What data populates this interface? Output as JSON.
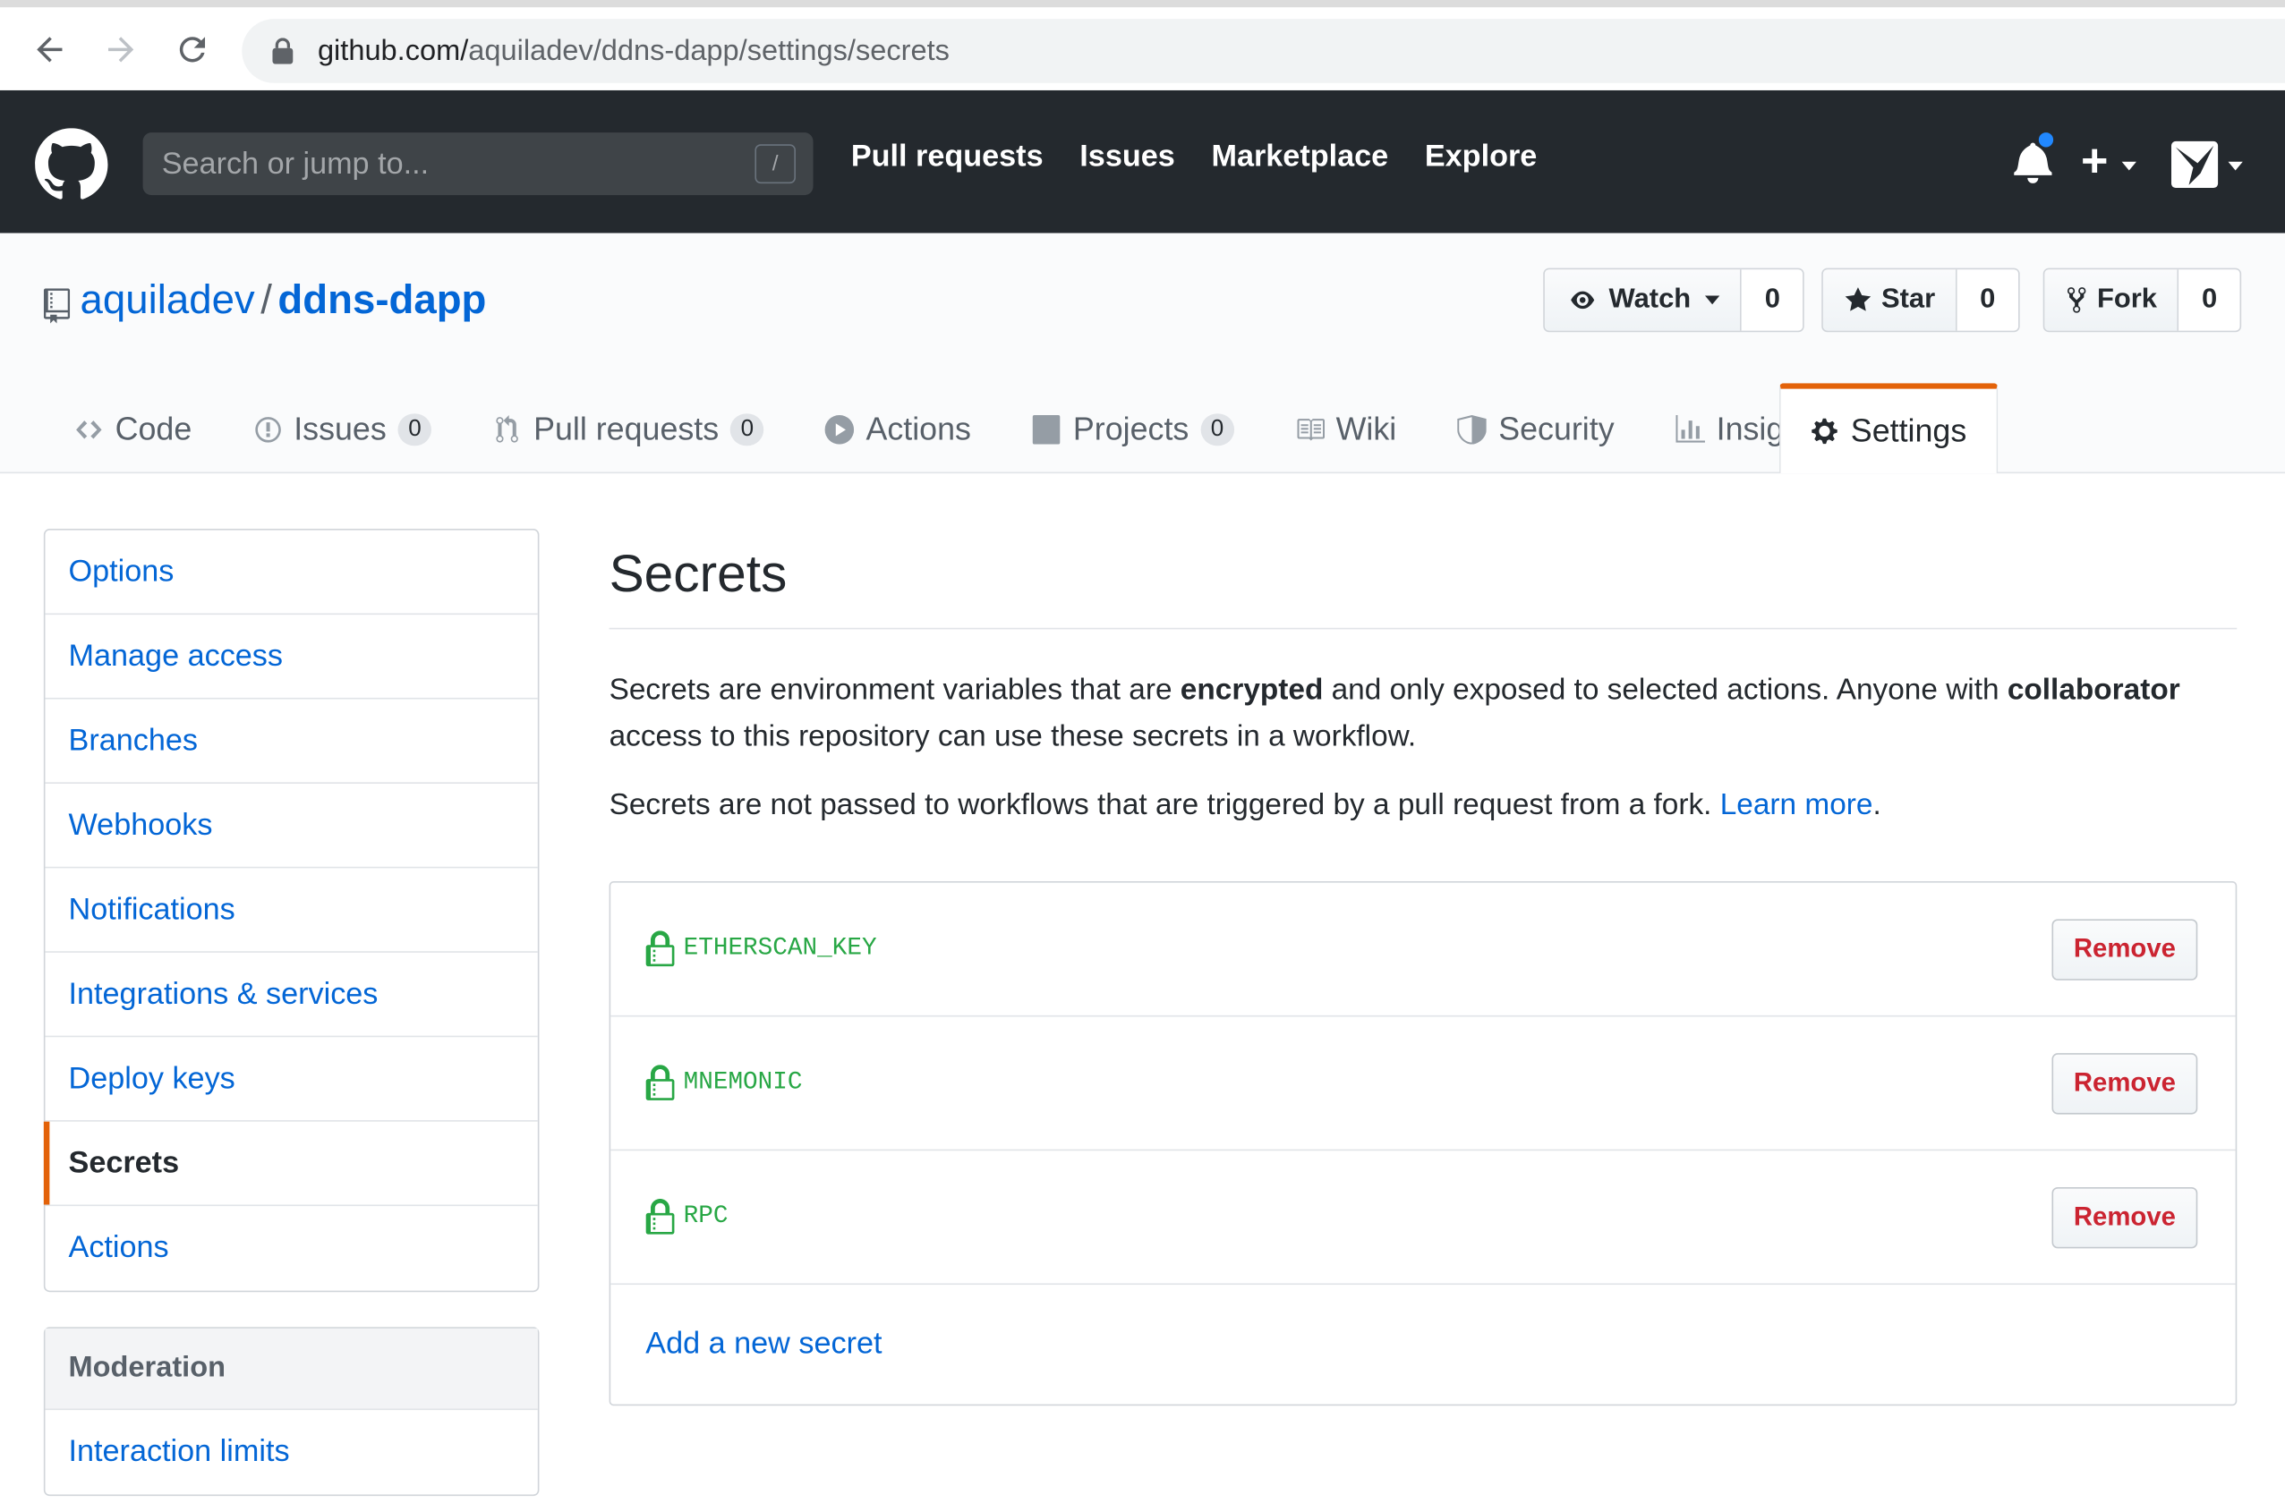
{
  "browser": {
    "url_host": "github.com/",
    "url_path": "aquiladev/ddns-dapp/settings/secrets"
  },
  "header": {
    "search_placeholder": "Search or jump to...",
    "search_shortcut": "/",
    "nav": [
      "Pull requests",
      "Issues",
      "Marketplace",
      "Explore"
    ],
    "plus": "+"
  },
  "repo": {
    "owner": "aquiladev",
    "separator": "/",
    "name": "ddns-dapp",
    "watch_label": "Watch",
    "watch_count": "0",
    "star_label": "Star",
    "star_count": "0",
    "fork_label": "Fork",
    "fork_count": "0"
  },
  "tabs": [
    {
      "label": "Code",
      "icon": "code-icon"
    },
    {
      "label": "Issues",
      "count": "0",
      "icon": "issue-icon"
    },
    {
      "label": "Pull requests",
      "count": "0",
      "icon": "pull-request-icon"
    },
    {
      "label": "Actions",
      "icon": "play-icon"
    },
    {
      "label": "Projects",
      "count": "0",
      "icon": "project-icon"
    },
    {
      "label": "Wiki",
      "icon": "book-icon"
    },
    {
      "label": "Security",
      "icon": "shield-icon"
    },
    {
      "label": "Insights",
      "icon": "graph-icon"
    },
    {
      "label": "Settings",
      "icon": "gear-icon",
      "selected": true
    }
  ],
  "sidebar": {
    "items": [
      "Options",
      "Manage access",
      "Branches",
      "Webhooks",
      "Notifications",
      "Integrations & services",
      "Deploy keys",
      "Secrets",
      "Actions"
    ],
    "selected": "Secrets",
    "moderation_heading": "Moderation",
    "moderation_items": [
      "Interaction limits"
    ]
  },
  "main": {
    "title": "Secrets",
    "desc_part1": "Secrets are environment variables that are ",
    "desc_bold1": "encrypted",
    "desc_part2": " and only exposed to selected actions. Anyone with ",
    "desc_bold2": "collaborator",
    "desc_part3": " access to this repository can use these secrets in a workflow.",
    "desc2_text": "Secrets are not passed to workflows that are triggered by a pull request from a fork. ",
    "learn_more": "Learn more",
    "period": ".",
    "secrets": [
      "ETHERSCAN_KEY",
      "MNEMONIC",
      "RPC"
    ],
    "remove_label": "Remove",
    "add_label": "Add a new secret"
  },
  "colors": {
    "accent": "#e36209",
    "link": "#0366d6",
    "secret_green": "#28a745",
    "danger": "#cb2431",
    "header_bg": "#24292e"
  }
}
